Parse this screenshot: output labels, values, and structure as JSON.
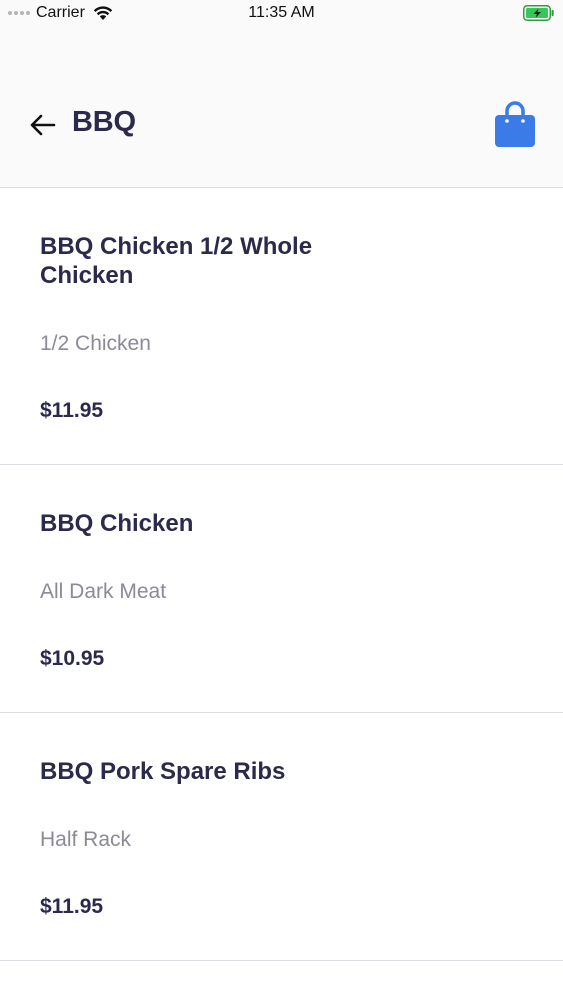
{
  "status_bar": {
    "carrier": "Carrier",
    "time": "11:35 AM",
    "icons": [
      "signal-dots-icon",
      "wifi-icon",
      "battery-charging-icon"
    ]
  },
  "header": {
    "title": "BBQ",
    "back_icon": "arrow-left-icon",
    "cart_icon": "shopping-bag-icon",
    "cart_color": "#3b7be8"
  },
  "menu": {
    "items": [
      {
        "name": "BBQ Chicken 1/2 Whole Chicken",
        "description": "1/2 Chicken",
        "price": "$11.95"
      },
      {
        "name": "BBQ Chicken",
        "description": "All Dark Meat",
        "price": "$10.95"
      },
      {
        "name": "BBQ Pork Spare Ribs",
        "description": "Half Rack",
        "price": "$11.95"
      }
    ]
  }
}
